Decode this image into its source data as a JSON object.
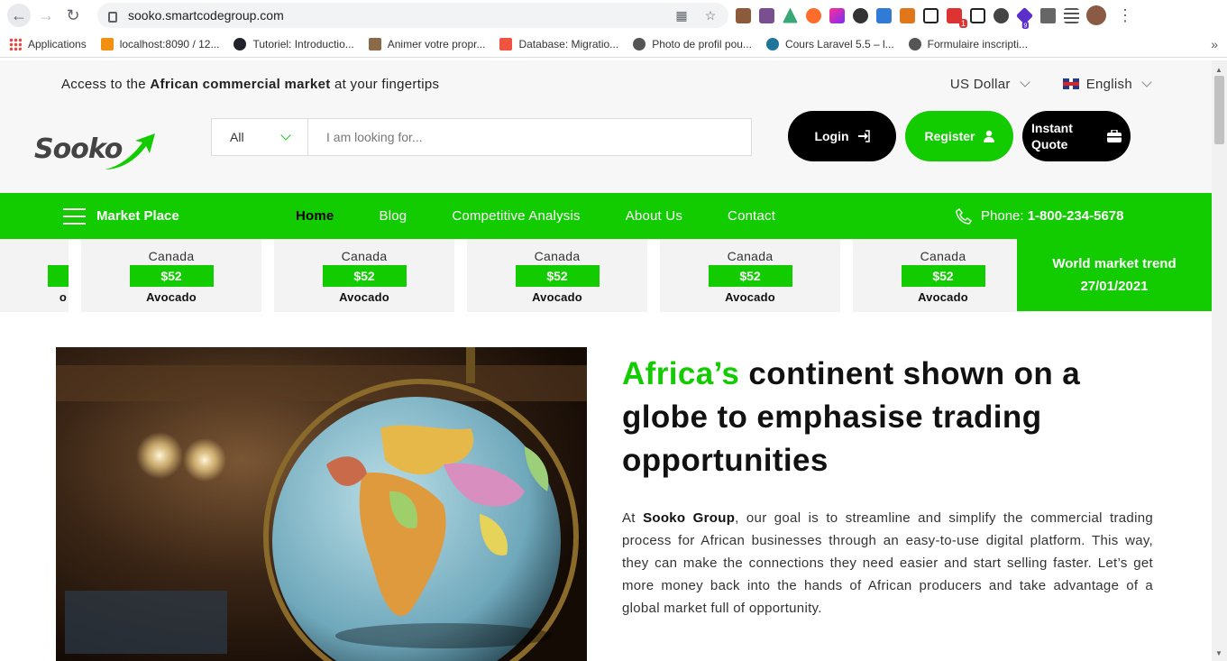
{
  "browser": {
    "url": "sooko.smartcodegroup.com",
    "bookmarks": [
      {
        "label": "Applications",
        "color": "#e8453c"
      },
      {
        "label": "localhost:8090 / 12...",
        "color": "#f29111"
      },
      {
        "label": "Tutoriel: Introductio...",
        "color": "#61dafb"
      },
      {
        "label": "Animer votre propr...",
        "color": "#8b6a4a"
      },
      {
        "label": "Database: Migratio...",
        "color": "#f05340"
      },
      {
        "label": "Photo de profil pou...",
        "color": "#555555"
      },
      {
        "label": "Cours Laravel 5.5 – l...",
        "color": "#21759b"
      },
      {
        "label": "Formulaire inscripti...",
        "color": "#555555"
      }
    ],
    "ext_badges": {
      "ext1": "1",
      "ext2": "9"
    }
  },
  "topbar": {
    "prefix": "Access to the ",
    "bold": "African commercial market",
    "suffix": " at your fingertips",
    "currency": "US Dollar",
    "language": "English"
  },
  "header": {
    "logo_text": "Sooko",
    "search_category": "All",
    "search_placeholder": "I am looking for...",
    "login_label": "Login",
    "register_label": "Register",
    "quote_label_1": "Instant",
    "quote_label_2": "Quote"
  },
  "nav": {
    "marketplace": "Market Place",
    "links": [
      "Home",
      "Blog",
      "Competitive Analysis",
      "About Us",
      "Contact"
    ],
    "phone_label": "Phone: ",
    "phone_number": "1-800-234-5678"
  },
  "ticker": {
    "partial_price_tail": "",
    "partial_product_tail": "o",
    "cards": [
      {
        "country": "Canada",
        "price": "$52",
        "product": "Avocado"
      },
      {
        "country": "Canada",
        "price": "$52",
        "product": "Avocado"
      },
      {
        "country": "Canada",
        "price": "$52",
        "product": "Avocado"
      },
      {
        "country": "Canada",
        "price": "$52",
        "product": "Avocado"
      },
      {
        "country": "Canada",
        "price": "$52",
        "product": "Avocado"
      }
    ],
    "trend_title": "World market trend",
    "trend_date": "27/01/2021"
  },
  "hero": {
    "title_green": "Africa’s",
    "title_rest": " continent shown on a globe to emphasise trading opportunities",
    "text_prefix": "At ",
    "text_bold": "Sooko Group",
    "text_rest": ", our goal is to streamline and simplify the commercial trading process for African businesses through an easy-to-use digital platform. This way, they can make the connections they need easier and start selling faster. Let’s get more money back into the hands of African producers and take advantage of a global market full of opportunity."
  }
}
